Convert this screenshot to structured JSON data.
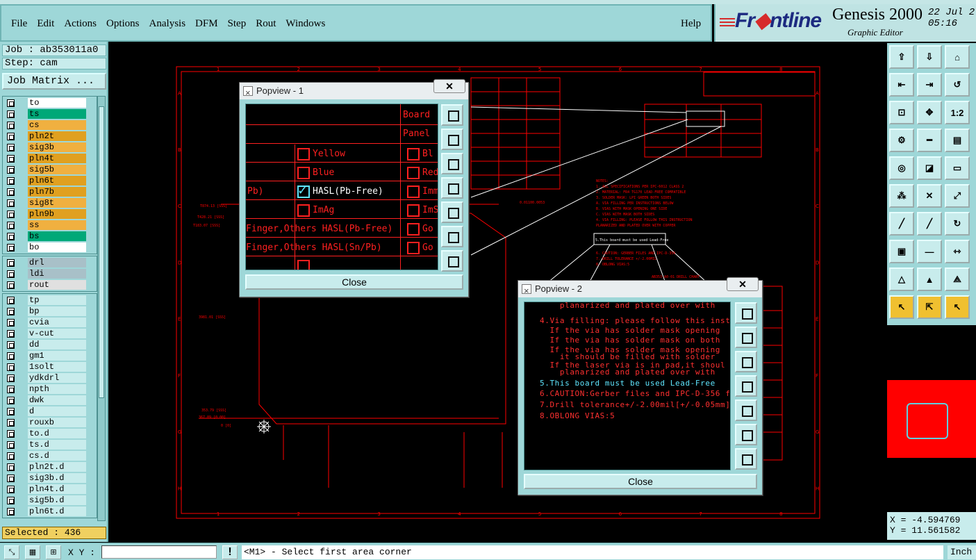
{
  "menu": {
    "items": [
      "File",
      "Edit",
      "Actions",
      "Options",
      "Analysis",
      "DFM",
      "Step",
      "Rout",
      "Windows"
    ],
    "help": "Help"
  },
  "brand": {
    "logo_front": "Fr",
    "logo_rest": "ntline",
    "product": "Genesis 2000",
    "subtitle": "Graphic Editor",
    "date": "22 Jul 2",
    "time": "05:16"
  },
  "left": {
    "job": "Job : ab353011a0",
    "step": "Step: cam",
    "job_matrix": "Job Matrix ...",
    "selected": "Selected : 436",
    "groups": [
      [
        {
          "name": "to",
          "color": "#ffffff",
          "mark": "↲"
        },
        {
          "name": "ts",
          "color": "#00a878"
        },
        {
          "name": "cs",
          "color": "#f0b040"
        },
        {
          "name": "pln2t",
          "color": "#e0a020"
        },
        {
          "name": "sig3b",
          "color": "#f0b040"
        },
        {
          "name": "pln4t",
          "color": "#e0a020"
        },
        {
          "name": "sig5b",
          "color": "#f0b040"
        },
        {
          "name": "pln6t",
          "color": "#e0a020"
        },
        {
          "name": "pln7b",
          "color": "#e0a020"
        },
        {
          "name": "sig8t",
          "color": "#f0b040"
        },
        {
          "name": "pln9b",
          "color": "#e0a020"
        },
        {
          "name": "ss",
          "color": "#f0b040"
        },
        {
          "name": "bs",
          "color": "#00a878"
        },
        {
          "name": "bo",
          "color": "#ffffff"
        }
      ],
      [
        {
          "name": "drl",
          "color": "#a8c0c8"
        },
        {
          "name": "ldi",
          "color": "#a8c0c8"
        },
        {
          "name": "rout",
          "color": "#e0e0e0"
        }
      ],
      [
        {
          "name": "tp",
          "color": "#c8ecec"
        },
        {
          "name": "bp",
          "color": "#c8ecec"
        },
        {
          "name": "cvia",
          "color": "#c8ecec"
        },
        {
          "name": "v-cut",
          "color": "#c8ecec"
        },
        {
          "name": "dd",
          "color": "#c8ecec",
          "mark": "↲"
        },
        {
          "name": "gm1",
          "color": "#c8ecec"
        },
        {
          "name": "1solt",
          "color": "#c8ecec"
        },
        {
          "name": "ydkdrl",
          "color": "#c8ecec"
        },
        {
          "name": "npth",
          "color": "#c8ecec"
        },
        {
          "name": "dwk",
          "color": "#c8ecec"
        },
        {
          "name": "d",
          "color": "#c8ecec"
        },
        {
          "name": "rouxb",
          "color": "#c8ecec"
        },
        {
          "name": "to.d",
          "color": "#c8ecec",
          "mark": "↲"
        },
        {
          "name": "ts.d",
          "color": "#c8ecec"
        },
        {
          "name": "cs.d",
          "color": "#c8ecec"
        },
        {
          "name": "pln2t.d",
          "color": "#c8ecec"
        },
        {
          "name": "sig3b.d",
          "color": "#c8ecec"
        },
        {
          "name": "pln4t.d",
          "color": "#c8ecec"
        },
        {
          "name": "sig5b.d",
          "color": "#c8ecec"
        },
        {
          "name": "pln6t.d",
          "color": "#c8ecec"
        }
      ]
    ]
  },
  "canvas": {
    "col_labels": [
      "1",
      "2",
      "3",
      "4",
      "5",
      "6",
      "7",
      "8"
    ],
    "row_labels": [
      "A",
      "B",
      "C",
      "D",
      "E",
      "F",
      "G",
      "H"
    ],
    "note_text": "5.This board must be used Lead-Free"
  },
  "popview1": {
    "title": "Popview - 1",
    "close": "Close",
    "rows": [
      {
        "label": "Board",
        "type": "hdr"
      },
      {
        "label": "Panel",
        "type": "hdr"
      },
      {
        "left": "Yellow",
        "right": "Bl"
      },
      {
        "left": "Blue",
        "right": "Red"
      },
      {
        "pre": "Pb)",
        "left": "HASL(Pb-Free)",
        "right": "Imm",
        "checked": true
      },
      {
        "left": "ImAg",
        "right": "ImS"
      },
      {
        "wide": "Finger,Others HASL(Pb-Free)",
        "right": "Go"
      },
      {
        "wide": "Finger,Others HASL(Sn/Pb)",
        "right": "Go"
      }
    ]
  },
  "popview2": {
    "title": "Popview - 2",
    "close": "Close",
    "lines": [
      {
        "t": "    planarized and plated over with",
        "c": "r"
      },
      {
        "t": "4.Via filling: please follow this inst",
        "c": "r"
      },
      {
        "t": "  If the via has solder mask opening",
        "c": "r"
      },
      {
        "t": "  If the via has solder mask on both",
        "c": "r"
      },
      {
        "t": "  If the via has solder mask opening",
        "c": "r"
      },
      {
        "t": "    it should be filled with solder",
        "c": "r"
      },
      {
        "t": "  If the laser via is in pad,it shoul",
        "c": "r"
      },
      {
        "t": "    planarized and plated over with",
        "c": "r"
      },
      {
        "t": "5.This board must be used Lead-Free",
        "c": "c"
      },
      {
        "t": "6.CAUTION:Gerber files and IPC-D-356 f",
        "c": "r"
      },
      {
        "t": "7.Drill tolerance+/-2.00mil[+/-0.05mm]",
        "c": "r"
      },
      {
        "t": "8.OBLONG VIAS:5",
        "c": "r"
      }
    ]
  },
  "right": {
    "tools": [
      "export-icon",
      "import-icon",
      "home-icon",
      "pan-left-icon",
      "pan-right-icon",
      "rotate-icon",
      "zoom-fit-icon",
      "zoom-center-icon",
      "one-to-one",
      "settings-icon",
      "line-icon",
      "layers-icon",
      "snap-icon",
      "measure-icon",
      "ruler-icon",
      "nodes-icon",
      "cross-icon",
      "connect-icon",
      "slash-red-icon",
      "slash-blue-icon",
      "arc-icon",
      "pad-icon",
      "line-h-icon",
      "dimension-icon",
      "triangle-icon",
      "triangle-a-icon",
      "triangle-b-icon",
      "pointer-icon",
      "pointer-box-icon",
      "pointer-outline-icon"
    ],
    "one_to_one": "1:2",
    "x": "X = -4.594769",
    "y": "Y = 11.561582"
  },
  "status": {
    "xy_label": "X Y :",
    "xy_value": "",
    "warn": "!",
    "message": "<M1> - Select first area corner",
    "unit": "Inch"
  }
}
